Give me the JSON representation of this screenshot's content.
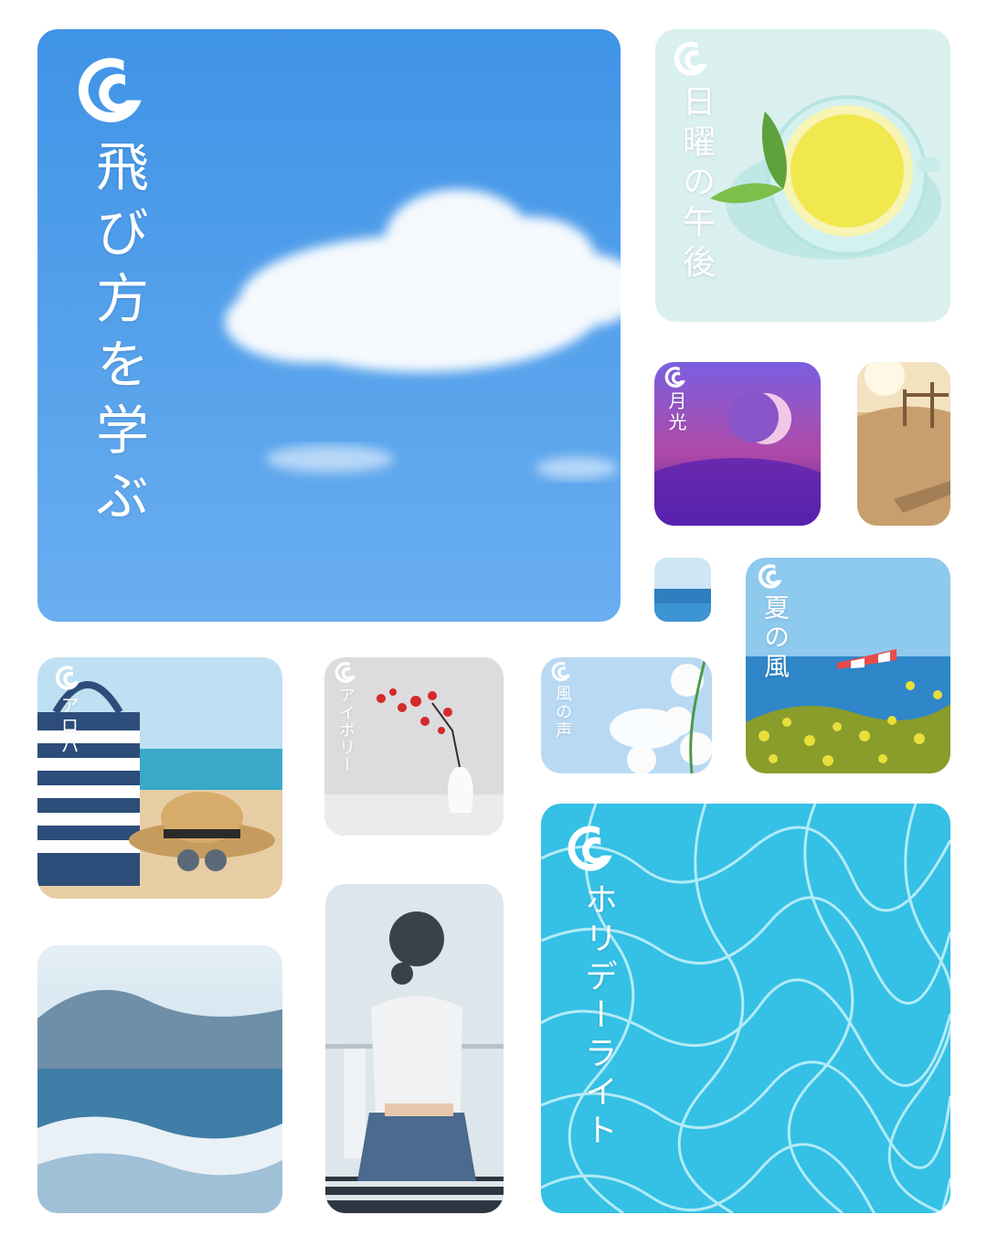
{
  "playlists": [
    {
      "id": "fly",
      "title": "飛び方を学ぶ",
      "scene": "sky-cloud"
    },
    {
      "id": "sunday",
      "title": "日曜の午後",
      "scene": "tea-cup"
    },
    {
      "id": "moon",
      "title": "月光",
      "scene": "crescent-moon"
    },
    {
      "id": "beach-path",
      "title": "",
      "scene": "sandy-beach-path"
    },
    {
      "id": "sea-small",
      "title": "",
      "scene": "sea-horizon"
    },
    {
      "id": "summer",
      "title": "夏の風",
      "scene": "sea-flowers"
    },
    {
      "id": "aloha",
      "title": "アロハ",
      "scene": "beach-bag"
    },
    {
      "id": "ivory",
      "title": "アイボリー",
      "scene": "vase-blossom"
    },
    {
      "id": "wind",
      "title": "風の声",
      "scene": "white-flowers"
    },
    {
      "id": "waves",
      "title": "",
      "scene": "ocean-waves"
    },
    {
      "id": "balcony",
      "title": "",
      "scene": "woman-balcony"
    },
    {
      "id": "holiday",
      "title": "ホリデーライト",
      "scene": "pool-water"
    }
  ],
  "colors": {
    "accent_white": "#ffffff",
    "sky_blue": "#4a9be8",
    "pool_cyan": "#3cc4e6",
    "moon_purple": "#5b2fb0"
  }
}
